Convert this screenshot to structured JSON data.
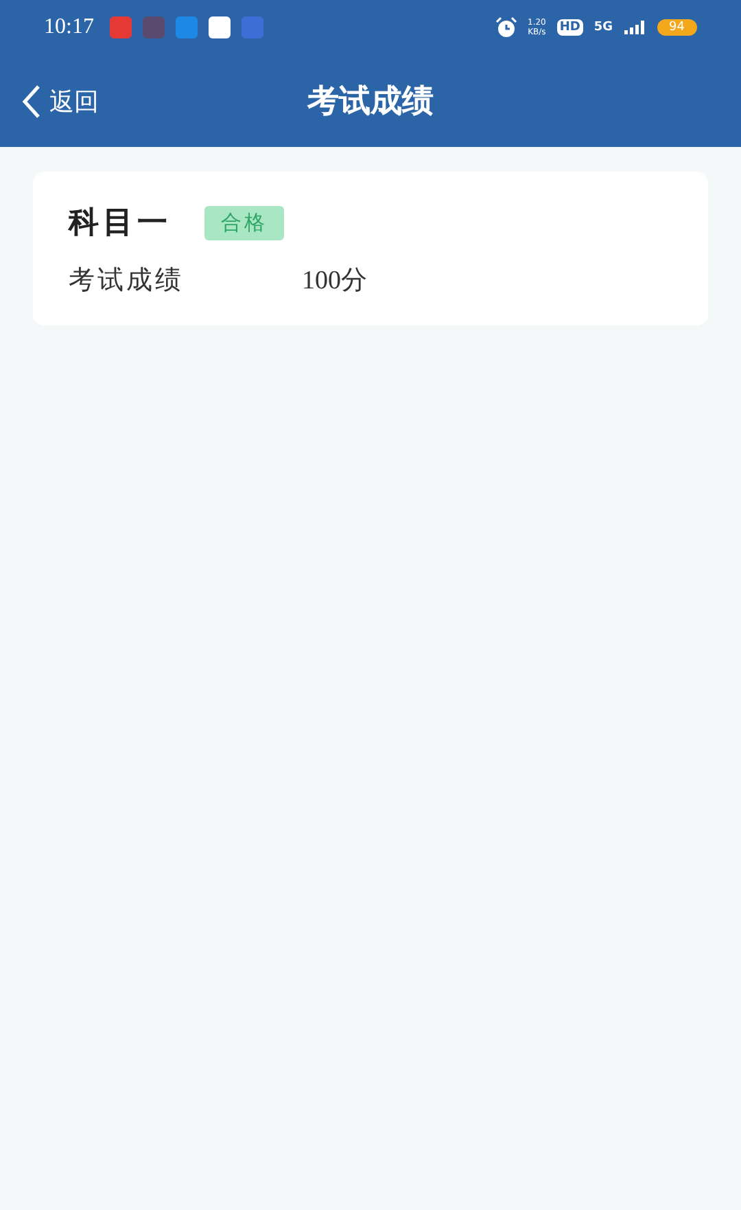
{
  "status_bar": {
    "time": "10:17",
    "net_speed_value": "1.20",
    "net_speed_unit": "KB/s",
    "hd": "HD",
    "network": "5G",
    "battery": "94"
  },
  "nav": {
    "back": "返回",
    "title": "考试成绩"
  },
  "results": [
    {
      "subject": "科目一",
      "status": "合格",
      "label": "考试成绩",
      "score": "100分"
    }
  ]
}
